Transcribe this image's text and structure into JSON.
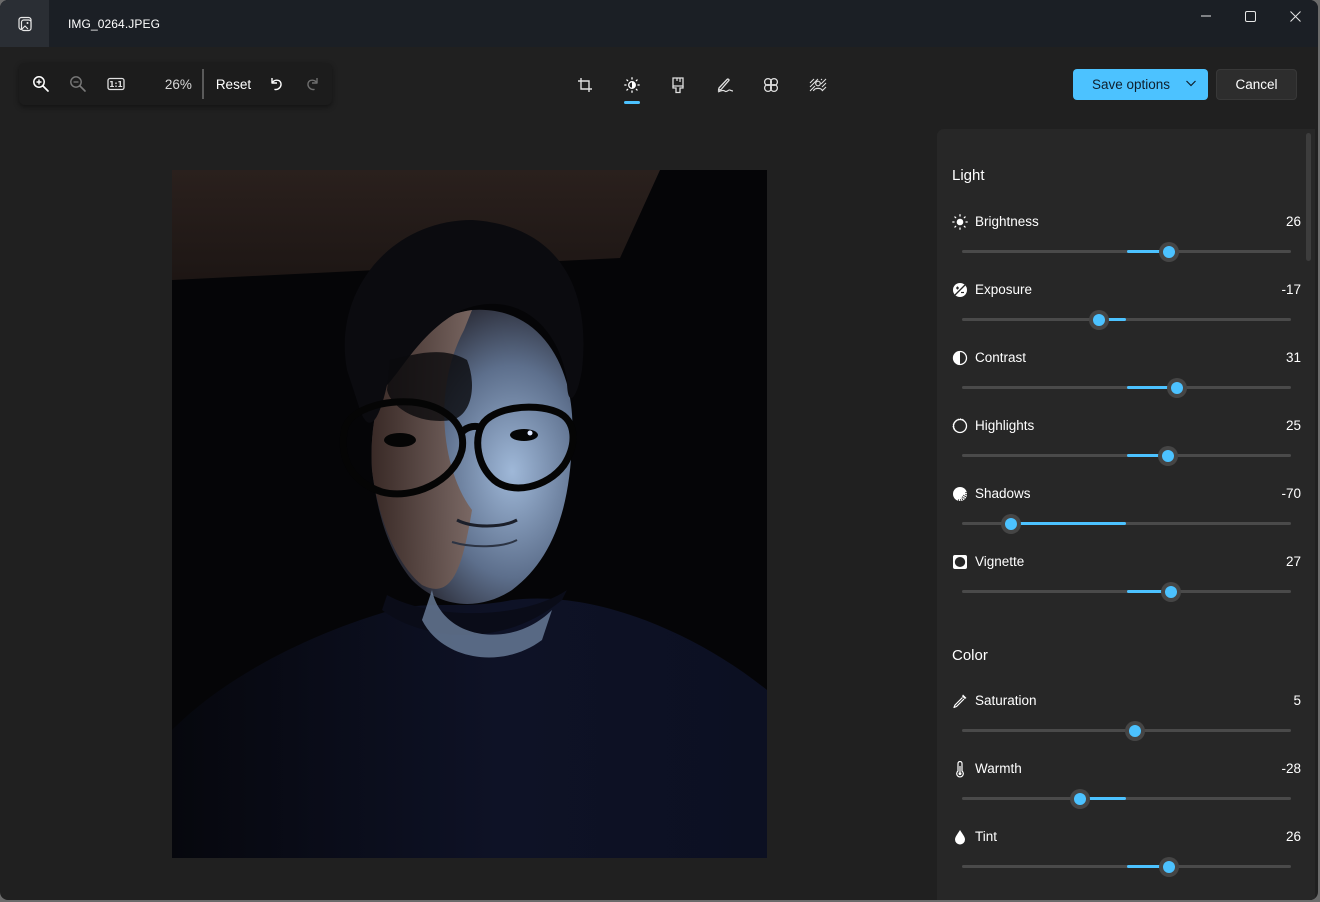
{
  "window": {
    "title": "IMG_0264.JPEG",
    "controls": [
      "minimize",
      "maximize",
      "close"
    ]
  },
  "toolbar": {
    "zoom_in_icon": "zoom-in-icon",
    "zoom_out_icon": "zoom-out-icon",
    "actual_size_icon": "actual-size-icon",
    "zoom_level": "26%",
    "reset_label": "Reset",
    "undo_icon": "undo-icon",
    "redo_icon": "redo-icon"
  },
  "edit_tools": [
    {
      "name": "crop",
      "icon": "crop-icon",
      "active": false
    },
    {
      "name": "adjustment",
      "icon": "brightness-icon",
      "active": true
    },
    {
      "name": "filter",
      "icon": "brush-icon",
      "active": false
    },
    {
      "name": "markup",
      "icon": "pen-icon",
      "active": false
    },
    {
      "name": "retouch",
      "icon": "retouch-icon",
      "active": false
    },
    {
      "name": "background",
      "icon": "background-blur-icon",
      "active": false
    }
  ],
  "actions": {
    "save_label": "Save options",
    "cancel_label": "Cancel"
  },
  "accent_color": "#4cc2ff",
  "panel": {
    "sections": [
      {
        "title": "Light",
        "adjustments": [
          {
            "label": "Brightness",
            "value": "26",
            "numeric": 26,
            "icon": "brightness-icon"
          },
          {
            "label": "Exposure",
            "value": "-17",
            "numeric": -17,
            "icon": "exposure-icon"
          },
          {
            "label": "Contrast",
            "value": "31",
            "numeric": 31,
            "icon": "contrast-icon"
          },
          {
            "label": "Highlights",
            "value": "25",
            "numeric": 25,
            "icon": "highlights-icon"
          },
          {
            "label": "Shadows",
            "value": "-70",
            "numeric": -70,
            "icon": "shadows-icon"
          },
          {
            "label": "Vignette",
            "value": "27",
            "numeric": 27,
            "icon": "vignette-icon"
          }
        ]
      },
      {
        "title": "Color",
        "adjustments": [
          {
            "label": "Saturation",
            "value": "5",
            "numeric": 5,
            "icon": "saturation-icon"
          },
          {
            "label": "Warmth",
            "value": "-28",
            "numeric": -28,
            "icon": "warmth-icon"
          },
          {
            "label": "Tint",
            "value": "26",
            "numeric": 26,
            "icon": "tint-icon"
          }
        ]
      }
    ],
    "slider_range": [
      -100,
      100
    ]
  },
  "photo": {
    "description": "Dimly lit portrait of a man with glasses and dark t-shirt"
  }
}
